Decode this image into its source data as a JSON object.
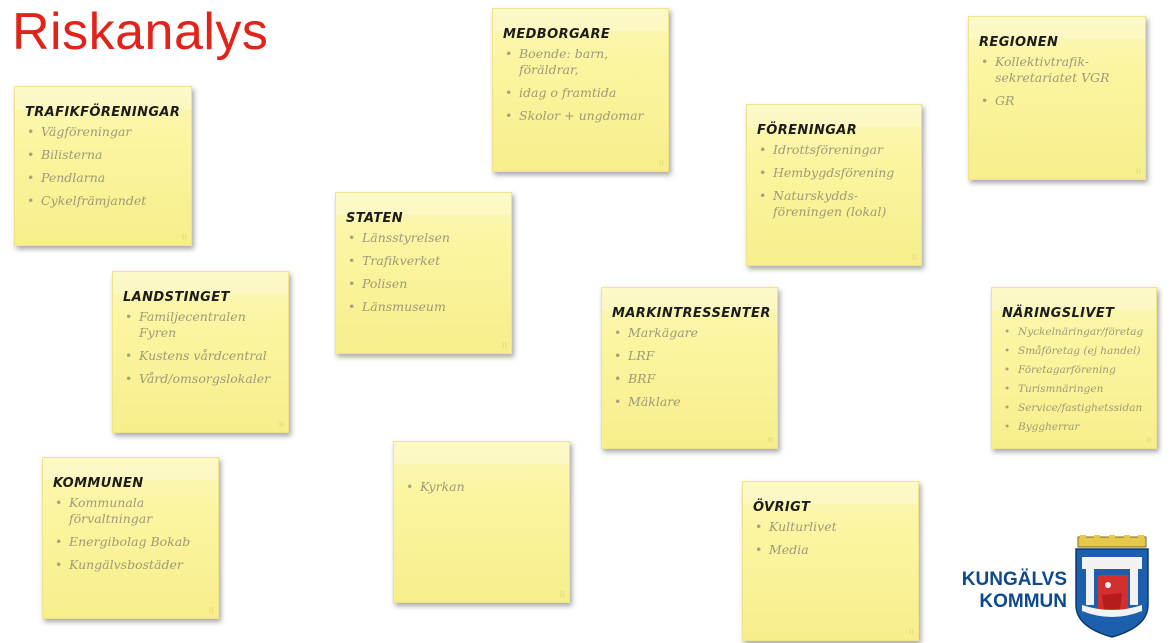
{
  "title": "Riskanalys",
  "notes": {
    "trafik": {
      "heading": "TRAFIKFÖRENINGAR",
      "items": [
        "Vägföreningar",
        "Bilisterna",
        "Pendlarna",
        "Cykelfrämjandet"
      ]
    },
    "medborgare": {
      "heading": "MEDBORGARE",
      "items": [
        "Boende: barn, föräldrar,",
        "idag o framtida",
        "Skolor + ungdomar"
      ]
    },
    "regionen": {
      "heading": "REGIONEN",
      "items": [
        "Kollektivtrafik-sekretariatet VGR",
        "GR"
      ]
    },
    "foreningar": {
      "heading": "FÖRENINGAR",
      "items": [
        "Idrottsföreningar",
        "Hembygdsförening",
        "Naturskydds-föreningen (lokal)"
      ]
    },
    "staten": {
      "heading": "STATEN",
      "items": [
        "Länsstyrelsen",
        "Trafikverket",
        "Polisen",
        "Länsmuseum"
      ]
    },
    "landstinget": {
      "heading": "LANDSTINGET",
      "items": [
        "Familjecentralen Fyren",
        "Kustens vårdcentral",
        "Vård/omsorgslokaler"
      ]
    },
    "mark": {
      "heading": "MARKINTRESSENTER",
      "items": [
        "Markägare",
        "LRF",
        "BRF",
        "Mäklare"
      ]
    },
    "naring": {
      "heading": "NÄRINGSLIVET",
      "items": [
        "Nyckelnäringar/företag",
        "Småföretag (ej handel)",
        "Företagarförening",
        "Turismnäringen",
        "Service/fastighetssidan",
        "Byggherrar"
      ]
    },
    "kommunen": {
      "heading": "KOMMUNEN",
      "items": [
        "Kommunala förvaltningar",
        "Energibolag Bokab",
        "Kungälvsbostäder"
      ]
    },
    "kyrkan": {
      "heading": "",
      "items": [
        "Kyrkan"
      ]
    },
    "ovrigt": {
      "heading": "ÖVRIGT",
      "items": [
        "Kulturlivet",
        "Media"
      ]
    }
  },
  "logo": {
    "line1": "KUNGÄLVS",
    "line2": "KOMMUN",
    "colors": {
      "text": "#0d4a8c",
      "shield_blue": "#1b5fad",
      "shield_red": "#d32f2f",
      "shield_gold": "#e6c84a"
    }
  },
  "colors": {
    "title": "#e2231a",
    "note": "#fbf5a0"
  }
}
